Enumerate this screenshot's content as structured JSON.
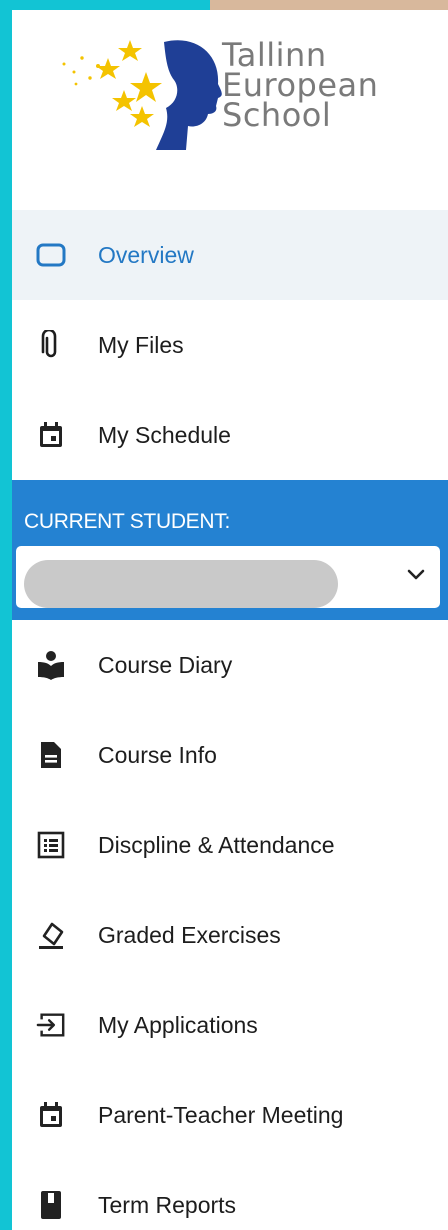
{
  "school": {
    "name_line1": "Tallinn",
    "name_line2": "European",
    "name_line3": "School"
  },
  "nav_top": [
    {
      "label": "Overview",
      "icon": "rounded-rectangle-icon",
      "active": true
    },
    {
      "label": "My Files",
      "icon": "paperclip-icon",
      "active": false
    },
    {
      "label": "My Schedule",
      "icon": "calendar-icon",
      "active": false
    }
  ],
  "student": {
    "heading": "CURRENT STUDENT:",
    "selected_value": ""
  },
  "nav_student": [
    {
      "label": "Course Diary",
      "icon": "reading-person-icon"
    },
    {
      "label": "Course Info",
      "icon": "document-icon"
    },
    {
      "label": "Discpline & Attendance",
      "icon": "list-icon"
    },
    {
      "label": "Graded Exercises",
      "icon": "eraser-icon"
    },
    {
      "label": "My Applications",
      "icon": "sign-in-arrow-icon"
    },
    {
      "label": "Parent-Teacher Meeting",
      "icon": "calendar-icon"
    },
    {
      "label": "Term Reports",
      "icon": "report-book-icon"
    }
  ],
  "colors": {
    "frame": "#12c4d4",
    "accent": "#2482d2",
    "active_text": "#2378c4",
    "active_bg": "#eef3f7"
  }
}
